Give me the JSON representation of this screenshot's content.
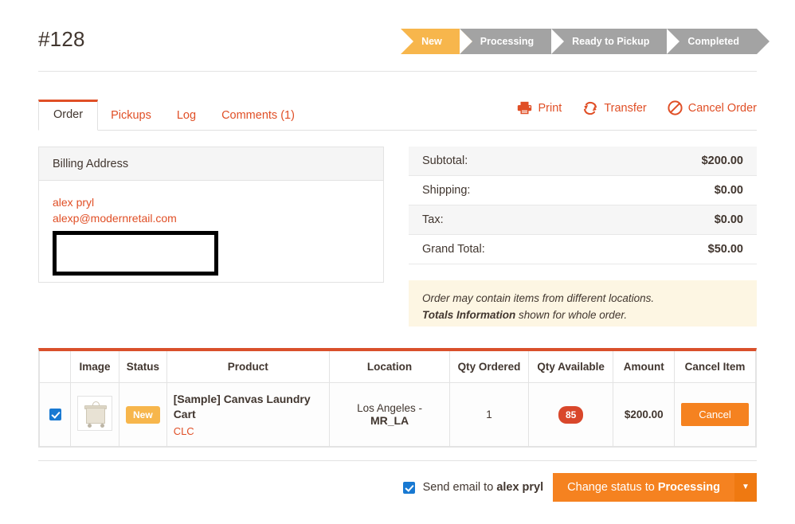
{
  "header": {
    "order_title": "#128"
  },
  "steps": [
    {
      "label": "New",
      "state": "active"
    },
    {
      "label": "Processing",
      "state": "inactive"
    },
    {
      "label": "Ready to Pickup",
      "state": "inactive"
    },
    {
      "label": "Completed",
      "state": "inactive"
    }
  ],
  "tabs": [
    {
      "label": "Order",
      "active": true
    },
    {
      "label": "Pickups",
      "active": false
    },
    {
      "label": "Log",
      "active": false
    },
    {
      "label": "Comments (1)",
      "active": false
    }
  ],
  "actions": [
    {
      "label": "Print",
      "icon": "printer-icon"
    },
    {
      "label": "Transfer",
      "icon": "transfer-icon"
    },
    {
      "label": "Cancel Order",
      "icon": "no-entry-icon"
    }
  ],
  "billing": {
    "title": "Billing Address",
    "name": "alex pryl",
    "email": "alexp@modernretail.com",
    "redacted": ""
  },
  "totals": [
    {
      "label": "Subtotal:",
      "value": "$200.00"
    },
    {
      "label": "Shipping:",
      "value": "$0.00"
    },
    {
      "label": "Tax:",
      "value": "$0.00"
    },
    {
      "label": "Grand Total:",
      "value": "$50.00"
    }
  ],
  "notice": {
    "line1": "Order may contain items from different locations.",
    "line2_bold": "Totals Information",
    "line2_rest": " shown for whole order."
  },
  "items_table": {
    "columns": [
      "",
      "Image",
      "Status",
      "Product",
      "Location",
      "Qty Ordered",
      "Qty Available",
      "Amount",
      "Cancel Item"
    ],
    "rows": [
      {
        "checked": true,
        "image_alt": "canvas-laundry-cart-thumbnail",
        "status": "New",
        "product_name": "[Sample] Canvas Laundry Cart",
        "product_sku": "CLC",
        "location_line1": "Los Angeles -",
        "location_line2": "MR_LA",
        "qty_ordered": "1",
        "qty_available": "85",
        "amount": "$200.00",
        "cancel_label": "Cancel"
      }
    ]
  },
  "footer": {
    "send_email_prefix": "Send email to ",
    "send_email_name": "alex pryl",
    "change_status_prefix": "Change status to ",
    "change_status_name": "Processing",
    "caret": "▼"
  },
  "colors": {
    "brand_red": "#e04f26",
    "table_top_border": "#d9502b",
    "amber": "#f7b64c",
    "orange_button": "#f58220",
    "qty_badge": "#d9472b",
    "step_inactive": "#a3a3a3",
    "checkbox_blue": "#1879d2",
    "notice_bg": "#fdf6e3"
  }
}
